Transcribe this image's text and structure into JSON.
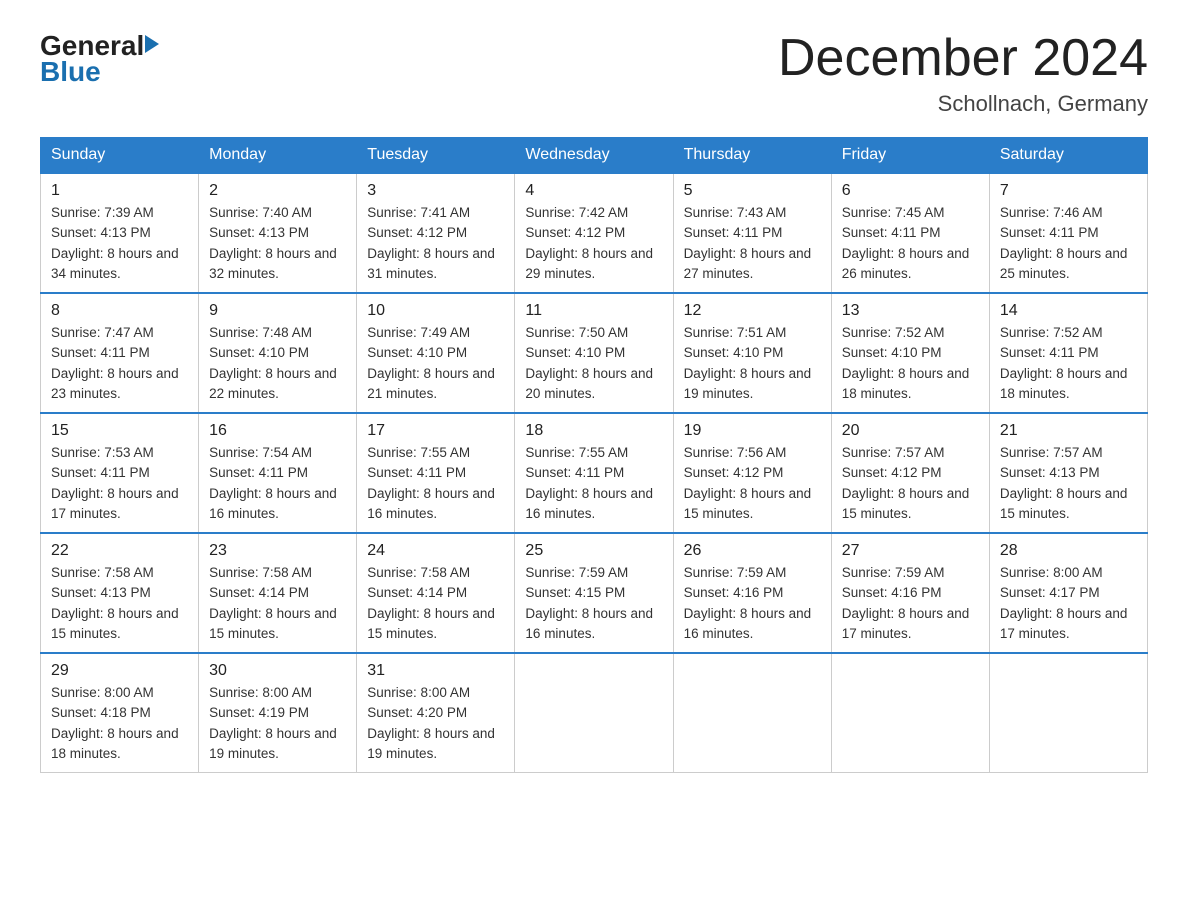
{
  "header": {
    "month_year": "December 2024",
    "location": "Schollnach, Germany",
    "logo_general": "General",
    "logo_blue": "Blue"
  },
  "days_of_week": [
    "Sunday",
    "Monday",
    "Tuesday",
    "Wednesday",
    "Thursday",
    "Friday",
    "Saturday"
  ],
  "weeks": [
    [
      {
        "day": "1",
        "sunrise": "7:39 AM",
        "sunset": "4:13 PM",
        "daylight": "8 hours and 34 minutes."
      },
      {
        "day": "2",
        "sunrise": "7:40 AM",
        "sunset": "4:13 PM",
        "daylight": "8 hours and 32 minutes."
      },
      {
        "day": "3",
        "sunrise": "7:41 AM",
        "sunset": "4:12 PM",
        "daylight": "8 hours and 31 minutes."
      },
      {
        "day": "4",
        "sunrise": "7:42 AM",
        "sunset": "4:12 PM",
        "daylight": "8 hours and 29 minutes."
      },
      {
        "day": "5",
        "sunrise": "7:43 AM",
        "sunset": "4:11 PM",
        "daylight": "8 hours and 27 minutes."
      },
      {
        "day": "6",
        "sunrise": "7:45 AM",
        "sunset": "4:11 PM",
        "daylight": "8 hours and 26 minutes."
      },
      {
        "day": "7",
        "sunrise": "7:46 AM",
        "sunset": "4:11 PM",
        "daylight": "8 hours and 25 minutes."
      }
    ],
    [
      {
        "day": "8",
        "sunrise": "7:47 AM",
        "sunset": "4:11 PM",
        "daylight": "8 hours and 23 minutes."
      },
      {
        "day": "9",
        "sunrise": "7:48 AM",
        "sunset": "4:10 PM",
        "daylight": "8 hours and 22 minutes."
      },
      {
        "day": "10",
        "sunrise": "7:49 AM",
        "sunset": "4:10 PM",
        "daylight": "8 hours and 21 minutes."
      },
      {
        "day": "11",
        "sunrise": "7:50 AM",
        "sunset": "4:10 PM",
        "daylight": "8 hours and 20 minutes."
      },
      {
        "day": "12",
        "sunrise": "7:51 AM",
        "sunset": "4:10 PM",
        "daylight": "8 hours and 19 minutes."
      },
      {
        "day": "13",
        "sunrise": "7:52 AM",
        "sunset": "4:10 PM",
        "daylight": "8 hours and 18 minutes."
      },
      {
        "day": "14",
        "sunrise": "7:52 AM",
        "sunset": "4:11 PM",
        "daylight": "8 hours and 18 minutes."
      }
    ],
    [
      {
        "day": "15",
        "sunrise": "7:53 AM",
        "sunset": "4:11 PM",
        "daylight": "8 hours and 17 minutes."
      },
      {
        "day": "16",
        "sunrise": "7:54 AM",
        "sunset": "4:11 PM",
        "daylight": "8 hours and 16 minutes."
      },
      {
        "day": "17",
        "sunrise": "7:55 AM",
        "sunset": "4:11 PM",
        "daylight": "8 hours and 16 minutes."
      },
      {
        "day": "18",
        "sunrise": "7:55 AM",
        "sunset": "4:11 PM",
        "daylight": "8 hours and 16 minutes."
      },
      {
        "day": "19",
        "sunrise": "7:56 AM",
        "sunset": "4:12 PM",
        "daylight": "8 hours and 15 minutes."
      },
      {
        "day": "20",
        "sunrise": "7:57 AM",
        "sunset": "4:12 PM",
        "daylight": "8 hours and 15 minutes."
      },
      {
        "day": "21",
        "sunrise": "7:57 AM",
        "sunset": "4:13 PM",
        "daylight": "8 hours and 15 minutes."
      }
    ],
    [
      {
        "day": "22",
        "sunrise": "7:58 AM",
        "sunset": "4:13 PM",
        "daylight": "8 hours and 15 minutes."
      },
      {
        "day": "23",
        "sunrise": "7:58 AM",
        "sunset": "4:14 PM",
        "daylight": "8 hours and 15 minutes."
      },
      {
        "day": "24",
        "sunrise": "7:58 AM",
        "sunset": "4:14 PM",
        "daylight": "8 hours and 15 minutes."
      },
      {
        "day": "25",
        "sunrise": "7:59 AM",
        "sunset": "4:15 PM",
        "daylight": "8 hours and 16 minutes."
      },
      {
        "day": "26",
        "sunrise": "7:59 AM",
        "sunset": "4:16 PM",
        "daylight": "8 hours and 16 minutes."
      },
      {
        "day": "27",
        "sunrise": "7:59 AM",
        "sunset": "4:16 PM",
        "daylight": "8 hours and 17 minutes."
      },
      {
        "day": "28",
        "sunrise": "8:00 AM",
        "sunset": "4:17 PM",
        "daylight": "8 hours and 17 minutes."
      }
    ],
    [
      {
        "day": "29",
        "sunrise": "8:00 AM",
        "sunset": "4:18 PM",
        "daylight": "8 hours and 18 minutes."
      },
      {
        "day": "30",
        "sunrise": "8:00 AM",
        "sunset": "4:19 PM",
        "daylight": "8 hours and 19 minutes."
      },
      {
        "day": "31",
        "sunrise": "8:00 AM",
        "sunset": "4:20 PM",
        "daylight": "8 hours and 19 minutes."
      },
      null,
      null,
      null,
      null
    ]
  ]
}
